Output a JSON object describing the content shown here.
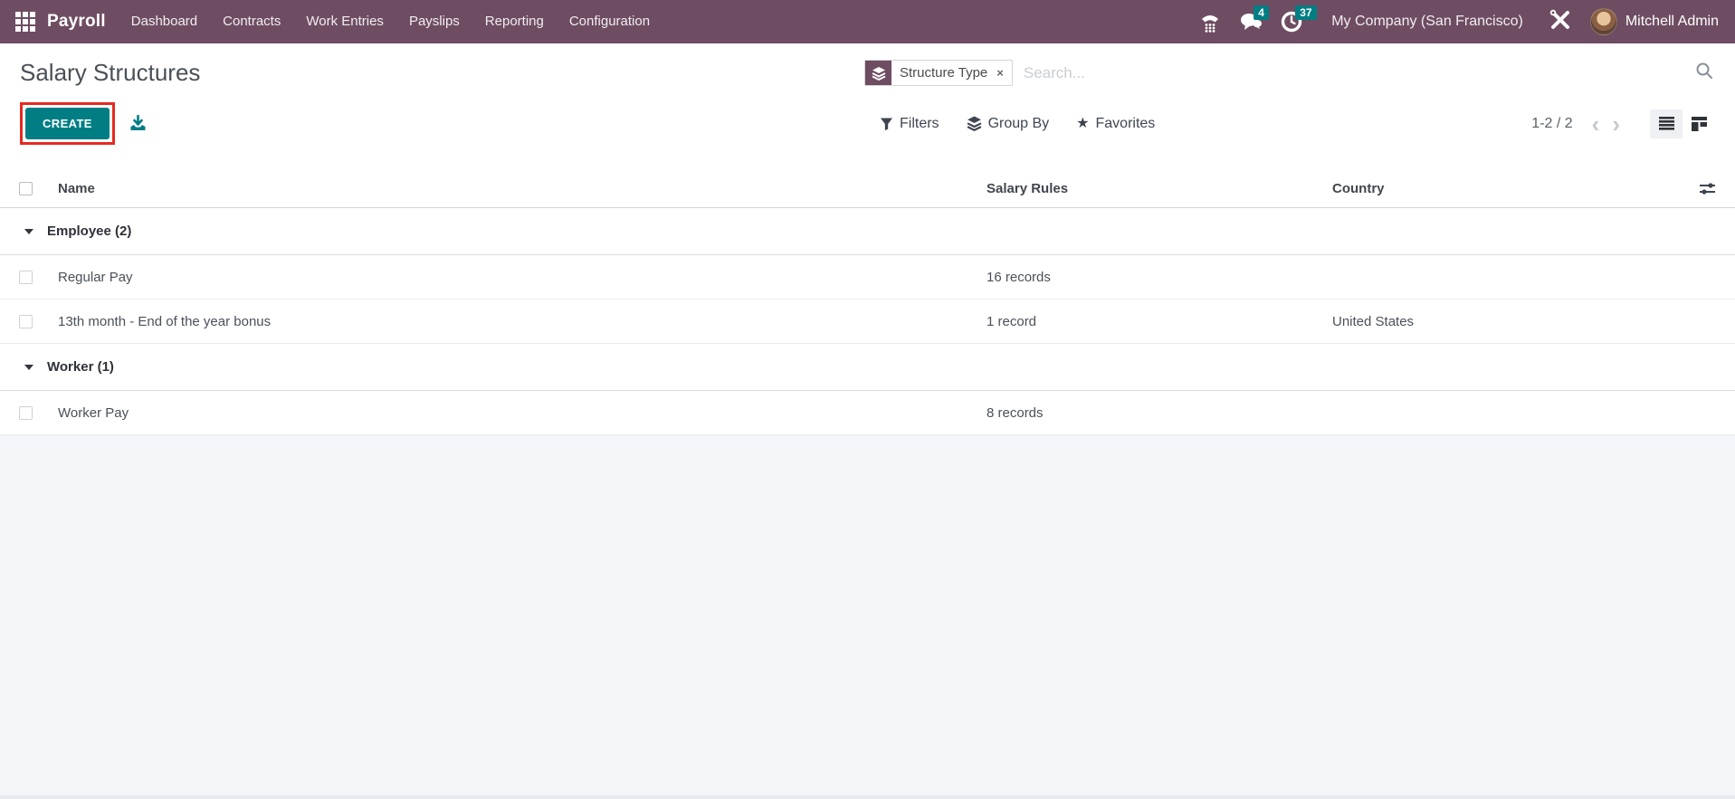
{
  "navbar": {
    "app_name": "Payroll",
    "menu_items": [
      "Dashboard",
      "Contracts",
      "Work Entries",
      "Payslips",
      "Reporting",
      "Configuration"
    ],
    "messages_badge": "4",
    "activities_badge": "37",
    "company": "My Company (San Francisco)",
    "user_name": "Mitchell Admin"
  },
  "header": {
    "title": "Salary Structures",
    "create_label": "CREATE",
    "filters_label": "Filters",
    "group_by_label": "Group By",
    "favorites_label": "Favorites",
    "pager": "1-2 / 2"
  },
  "search": {
    "facet_label": "Structure Type",
    "placeholder": "Search..."
  },
  "glyphs": {
    "close": "×",
    "prev": "‹",
    "next": "›",
    "star": "★"
  },
  "table": {
    "columns": [
      "Name",
      "Salary Rules",
      "Country"
    ],
    "groups": [
      {
        "label": "Employee (2)",
        "rows": [
          {
            "name": "Regular Pay",
            "salary_rules": "16 records",
            "country": ""
          },
          {
            "name": "13th month - End of the year bonus",
            "salary_rules": "1 record",
            "country": "United States"
          }
        ]
      },
      {
        "label": "Worker (1)",
        "rows": [
          {
            "name": "Worker Pay",
            "salary_rules": "8 records",
            "country": ""
          }
        ]
      }
    ]
  },
  "colors": {
    "navbar": "#6E4D62",
    "accent_teal": "#017E84",
    "annotation_red": "#e52a20"
  }
}
